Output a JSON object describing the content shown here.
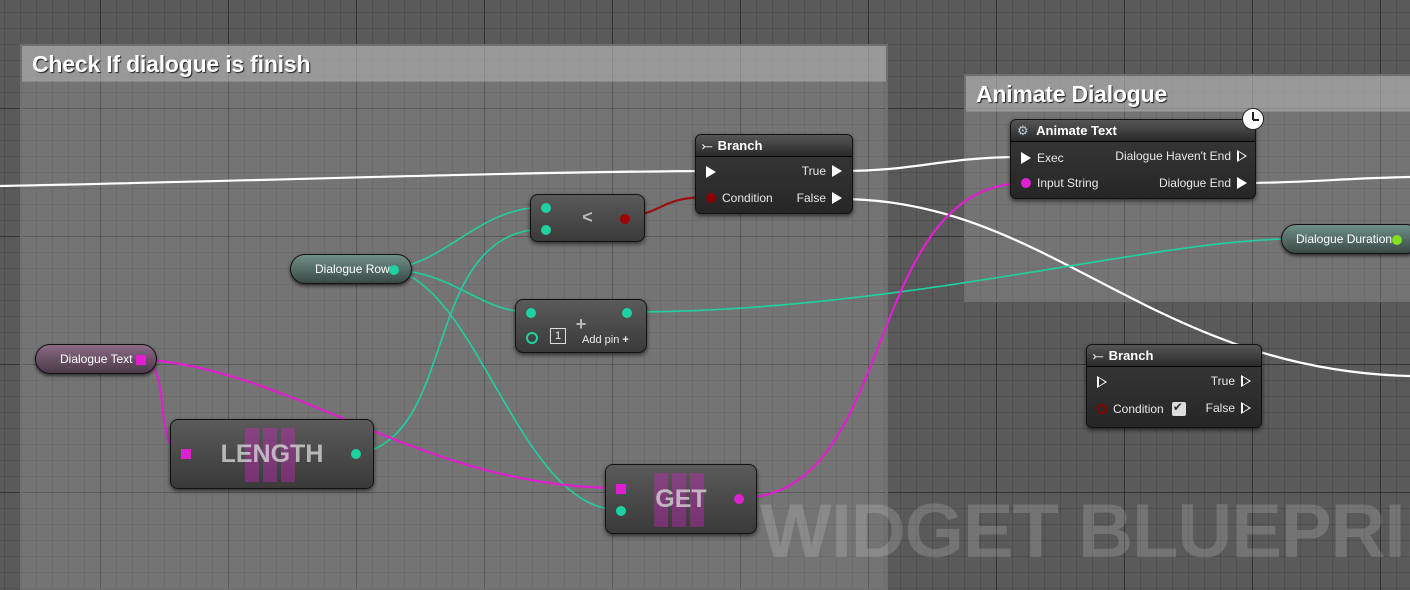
{
  "comments": {
    "check": {
      "title": "Check If dialogue is finish"
    },
    "animate": {
      "title": "Animate Dialogue"
    }
  },
  "nodes": {
    "branch_main": {
      "title": "Branch",
      "pins": {
        "condition": "Condition",
        "true": "True",
        "false": "False"
      }
    },
    "less": {
      "symbol": "<"
    },
    "add": {
      "symbol": "+",
      "add_pin": "Add pin",
      "default_value": "1"
    },
    "length": {
      "label": "LENGTH"
    },
    "get": {
      "label": "GET"
    },
    "animate_text": {
      "title": "Animate Text",
      "pins": {
        "exec": "Exec",
        "input_string": "Input String",
        "havent_end": "Dialogue Haven't End",
        "end": "Dialogue End"
      }
    },
    "branch_free": {
      "title": "Branch",
      "pins": {
        "condition": "Condition",
        "true": "True",
        "false": "False"
      }
    }
  },
  "variables": {
    "dialogue_row": "Dialogue Row",
    "dialogue_text": "Dialogue Text",
    "dialogue_duration": "Dialogue Duration"
  },
  "watermark": "WIDGET BLUEPRINT",
  "colors": {
    "exec": "#ffffff",
    "integer": "#1ed1a0",
    "string": "#e020d0",
    "boolean": "#8a0000"
  },
  "icons": {
    "branch": "branch-icon",
    "function": "gear-icon",
    "latent": "clock-icon"
  }
}
